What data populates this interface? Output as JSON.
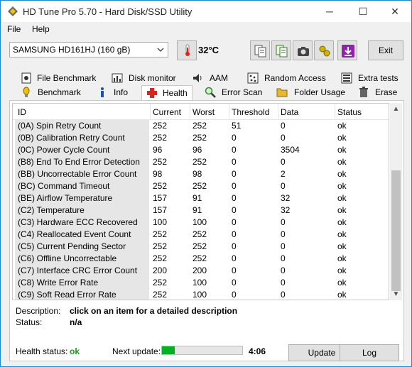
{
  "window": {
    "title": "HD Tune Pro 5.70 - Hard Disk/SSD Utility",
    "minimize": "─",
    "maximize": "☐",
    "close": "✕"
  },
  "menu": {
    "file": "File",
    "help": "Help"
  },
  "toolbar": {
    "drive": "SAMSUNG HD161HJ (160 gB)",
    "temperature": "32°C",
    "exit_label": "Exit"
  },
  "tabs_top": [
    {
      "label": "File Benchmark",
      "icon": "file-benchmark-icon"
    },
    {
      "label": "Disk monitor",
      "icon": "disk-monitor-icon"
    },
    {
      "label": "AAM",
      "icon": "speaker-icon"
    },
    {
      "label": "Random Access",
      "icon": "random-access-icon"
    },
    {
      "label": "Extra tests",
      "icon": "extra-tests-icon"
    }
  ],
  "tabs_bottom": [
    {
      "label": "Benchmark",
      "icon": "benchmark-icon"
    },
    {
      "label": "Info",
      "icon": "info-icon"
    },
    {
      "label": "Health",
      "icon": "health-cross-icon"
    },
    {
      "label": "Error Scan",
      "icon": "magnifier-icon"
    },
    {
      "label": "Folder Usage",
      "icon": "folder-icon"
    },
    {
      "label": "Erase",
      "icon": "trash-icon"
    }
  ],
  "active_tab": "Health",
  "table": {
    "headers": [
      "ID",
      "Current",
      "Worst",
      "Threshold",
      "Data",
      "Status"
    ],
    "rows": [
      [
        "(0A) Spin Retry Count",
        "252",
        "252",
        "51",
        "0",
        "ok"
      ],
      [
        "(0B) Calibration Retry Count",
        "252",
        "252",
        "0",
        "0",
        "ok"
      ],
      [
        "(0C) Power Cycle Count",
        "96",
        "96",
        "0",
        "3504",
        "ok"
      ],
      [
        "(B8) End To End Error Detection",
        "252",
        "252",
        "0",
        "0",
        "ok"
      ],
      [
        "(BB) Uncorrectable Error Count",
        "98",
        "98",
        "0",
        "2",
        "ok"
      ],
      [
        "(BC) Command Timeout",
        "252",
        "252",
        "0",
        "0",
        "ok"
      ],
      [
        "(BE) Airflow Temperature",
        "157",
        "91",
        "0",
        "32",
        "ok"
      ],
      [
        "(C2) Temperature",
        "157",
        "91",
        "0",
        "32",
        "ok"
      ],
      [
        "(C3) Hardware ECC Recovered",
        "100",
        "100",
        "0",
        "0",
        "ok"
      ],
      [
        "(C4) Reallocated Event Count",
        "252",
        "252",
        "0",
        "0",
        "ok"
      ],
      [
        "(C5) Current Pending Sector",
        "252",
        "252",
        "0",
        "0",
        "ok"
      ],
      [
        "(C6) Offline Uncorrectable",
        "252",
        "252",
        "0",
        "0",
        "ok"
      ],
      [
        "(C7) Interface CRC Error Count",
        "200",
        "200",
        "0",
        "0",
        "ok"
      ],
      [
        "(C8) Write Error Rate",
        "252",
        "100",
        "0",
        "0",
        "ok"
      ],
      [
        "(C9) Soft Read Error Rate",
        "252",
        "100",
        "0",
        "0",
        "ok"
      ]
    ]
  },
  "details": {
    "description_label": "Description:",
    "description_value": "click on an item for a detailed description",
    "status_label": "Status:",
    "status_value": "n/a"
  },
  "footer": {
    "health_label": "Health status:",
    "health_value": "ok",
    "next_update_label": "Next update:",
    "next_update_progress_pct": 16,
    "time": "4:06",
    "update_label": "Update",
    "log_label": "Log"
  },
  "colors": {
    "ok_green": "#1a9e1a",
    "progress_green": "#06b025",
    "accent": "#1a8ad4"
  }
}
